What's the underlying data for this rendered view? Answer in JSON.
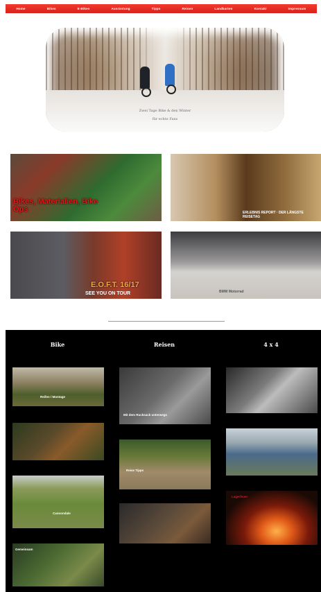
{
  "nav": {
    "items": [
      "Home",
      "Bikes",
      "E-Bikes",
      "Ausrüstung",
      "Tipps",
      "Reisen",
      "Landkarten",
      "Kontakt",
      "Impressum"
    ]
  },
  "hero": {
    "caption_line1": "Zwei Tage Bike & den Winter",
    "caption_line2": "für echte Fans"
  },
  "tiles": [
    {
      "title": "Bikes, Materialien, Bike Ops",
      "small": ""
    },
    {
      "title": "",
      "small": "ERLEBNIS REPORT · DER LÄNGSTE REISETAG"
    },
    {
      "title": "E.O.F.T. 16/17",
      "small": "SEE YOU ON TOUR"
    },
    {
      "title": "",
      "small": "BMW Motorrad"
    }
  ],
  "sections": {
    "bike": "Bike",
    "reisen": "Reisen",
    "four_by_four": "4 x 4"
  },
  "bike_thumbs": [
    {
      "caption": "Reifen / Montage"
    },
    {
      "caption": ""
    },
    {
      "caption": "Cannondale"
    },
    {
      "caption": "Gemeinsam"
    }
  ],
  "reisen_thumbs": [
    {
      "caption": "Mit dem Rucksack unterwegs"
    },
    {
      "caption": "Reise Tipps"
    },
    {
      "caption": ""
    }
  ],
  "fxf_thumbs": [
    {
      "caption": ""
    },
    {
      "caption": ""
    },
    {
      "caption": "Lagerfeuer"
    }
  ],
  "colors": {
    "nav_red": "#e22a22",
    "dark_bg": "#000000",
    "accent_red": "#e01818"
  }
}
